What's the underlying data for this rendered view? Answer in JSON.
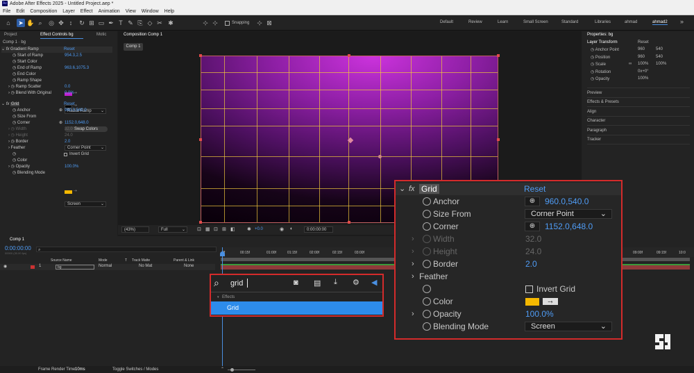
{
  "app": {
    "title": "Adobe After Effects 2025 - Untitled Project.aep *",
    "icon": "Ae"
  },
  "menu": [
    "File",
    "Edit",
    "Composition",
    "Layer",
    "Effect",
    "Animation",
    "View",
    "Window",
    "Help"
  ],
  "toolbar": {
    "snapping": "Snapping",
    "workspaces": [
      "Default",
      "Review",
      "Learn",
      "Small Screen",
      "Standard",
      "Libraries",
      "ahmad",
      "ahmad2"
    ],
    "current_workspace": "ahmad2"
  },
  "left_panel": {
    "tabs": [
      "Project",
      "Effect Controls bg",
      "Motic"
    ],
    "layer_path": "Comp 1 · bg",
    "gradient_ramp": {
      "name": "Gradient Ramp",
      "reset": "Reset",
      "props": [
        {
          "name": "Start of Ramp",
          "value": "954.3,2.5"
        },
        {
          "name": "Start Color",
          "value": ""
        },
        {
          "name": "End of Ramp",
          "value": "963.6,1075.3"
        },
        {
          "name": "End Color",
          "value": ""
        },
        {
          "name": "Ramp Shape",
          "value": "Radial Ramp"
        },
        {
          "name": "Ramp Scatter",
          "value": "0.0"
        },
        {
          "name": "Blend With Original",
          "value": "0.0%"
        }
      ],
      "swap": "Swap Colors"
    },
    "grid": {
      "name": "Grid",
      "reset": "Reset",
      "props": [
        {
          "name": "Anchor",
          "value": "960.0,540.0"
        },
        {
          "name": "Size From",
          "value": "Corner Point"
        },
        {
          "name": "Corner",
          "value": "1152.0,648.0"
        },
        {
          "name": "Width",
          "value": "32.0"
        },
        {
          "name": "Height",
          "value": "24.0"
        },
        {
          "name": "Border",
          "value": "2.0"
        },
        {
          "name": "Feather",
          "value": ""
        },
        {
          "name": "Invert Grid",
          "value": ""
        },
        {
          "name": "Color",
          "value": ""
        },
        {
          "name": "Opacity",
          "value": "100.0%"
        },
        {
          "name": "Blending Mode",
          "value": "Screen"
        }
      ]
    }
  },
  "composition": {
    "tab": "Composition Comp 1",
    "crumb": "Comp 1",
    "zoom": "(43%)",
    "quality": "Full",
    "exposure": "+0.0",
    "timecode": "0:00:00:00"
  },
  "properties": {
    "title": "Properties: bg",
    "section": "Layer Transform",
    "reset": "Reset",
    "rows": [
      {
        "name": "Anchor Point",
        "v1": "960",
        "v2": "540"
      },
      {
        "name": "Position",
        "v1": "960",
        "v2": "540"
      },
      {
        "name": "Scale",
        "v1": "100%",
        "v2": "100%"
      },
      {
        "name": "Rotation",
        "v1": "0x+0°",
        "v2": ""
      },
      {
        "name": "Opacity",
        "v1": "100%",
        "v2": ""
      }
    ],
    "panels": [
      "Preview",
      "Effects & Presets",
      "Align",
      "Character",
      "Paragraph",
      "Tracker"
    ]
  },
  "timeline": {
    "tab": "Comp 1",
    "timecode": "0:00:00:00",
    "frames": "00000 (30.00 fps)",
    "columns": [
      "Source Name",
      "Mode",
      "T",
      "Track Matte",
      "Parent & Link"
    ],
    "layer": {
      "num": "1",
      "name": "bg",
      "mode": "Normal",
      "matte": "No Mat",
      "parent": "None"
    },
    "ruler": [
      "0f",
      "00:15f",
      "01:00f",
      "01:15f",
      "02:00f",
      "02:15f",
      "03:00f"
    ],
    "ruler_end": [
      "09:00f",
      "09:15f",
      "10:0"
    ]
  },
  "status": {
    "render_label": "Frame Render Time:",
    "render_value": "10ms",
    "toggle": "Toggle Switches / Modes"
  },
  "search_popup": {
    "query": "grid",
    "category": "Effects",
    "result": "Grid"
  },
  "zoomed": {
    "header": "Grid",
    "fx": "fx",
    "reset": "Reset",
    "rows": [
      {
        "name": "Anchor",
        "value": "960.0,540.0"
      },
      {
        "name": "Size From",
        "value": "Corner Point"
      },
      {
        "name": "Corner",
        "value": "1152.0,648.0"
      },
      {
        "name": "Width",
        "value": "32.0"
      },
      {
        "name": "Height",
        "value": "24.0"
      },
      {
        "name": "Border",
        "value": "2.0"
      },
      {
        "name": "Feather",
        "value": ""
      },
      {
        "name": "",
        "value": "Invert Grid"
      },
      {
        "name": "Color",
        "value": ""
      },
      {
        "name": "Opacity",
        "value": "100.0%"
      },
      {
        "name": "Blending Mode",
        "value": "Screen"
      }
    ]
  },
  "colors": {
    "accent": "#2d8ceb",
    "grid_color": "#f5b800",
    "highlight": "#d42b2b"
  }
}
